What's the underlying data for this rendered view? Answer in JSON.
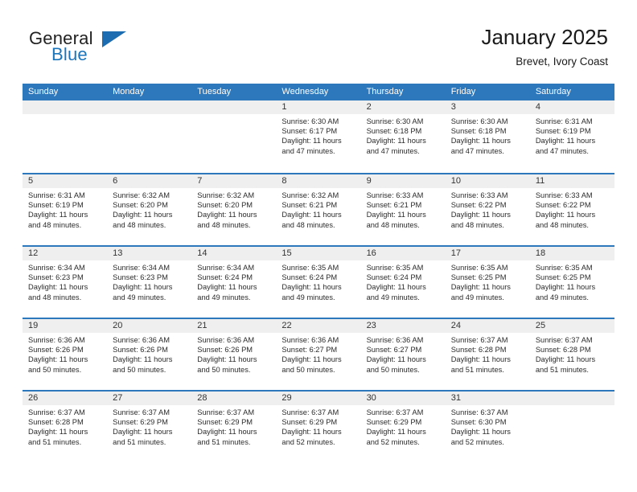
{
  "brand": {
    "word1": "General",
    "word2": "Blue",
    "flag_icon": "triangle-flag-icon"
  },
  "header": {
    "title": "January 2025",
    "subtitle": "Brevet, Ivory Coast"
  },
  "colors": {
    "header_blue": "#2d78bd",
    "brand_blue": "#1b75bb",
    "daynum_band": "#efefef",
    "text": "#2b2b2b"
  },
  "weekdays": [
    "Sunday",
    "Monday",
    "Tuesday",
    "Wednesday",
    "Thursday",
    "Friday",
    "Saturday"
  ],
  "weeks": [
    [
      {
        "day": "",
        "sunrise": "",
        "sunset": "",
        "daylight1": "",
        "daylight2": ""
      },
      {
        "day": "",
        "sunrise": "",
        "sunset": "",
        "daylight1": "",
        "daylight2": ""
      },
      {
        "day": "",
        "sunrise": "",
        "sunset": "",
        "daylight1": "",
        "daylight2": ""
      },
      {
        "day": "1",
        "sunrise": "Sunrise: 6:30 AM",
        "sunset": "Sunset: 6:17 PM",
        "daylight1": "Daylight: 11 hours",
        "daylight2": "and 47 minutes."
      },
      {
        "day": "2",
        "sunrise": "Sunrise: 6:30 AM",
        "sunset": "Sunset: 6:18 PM",
        "daylight1": "Daylight: 11 hours",
        "daylight2": "and 47 minutes."
      },
      {
        "day": "3",
        "sunrise": "Sunrise: 6:30 AM",
        "sunset": "Sunset: 6:18 PM",
        "daylight1": "Daylight: 11 hours",
        "daylight2": "and 47 minutes."
      },
      {
        "day": "4",
        "sunrise": "Sunrise: 6:31 AM",
        "sunset": "Sunset: 6:19 PM",
        "daylight1": "Daylight: 11 hours",
        "daylight2": "and 47 minutes."
      }
    ],
    [
      {
        "day": "5",
        "sunrise": "Sunrise: 6:31 AM",
        "sunset": "Sunset: 6:19 PM",
        "daylight1": "Daylight: 11 hours",
        "daylight2": "and 48 minutes."
      },
      {
        "day": "6",
        "sunrise": "Sunrise: 6:32 AM",
        "sunset": "Sunset: 6:20 PM",
        "daylight1": "Daylight: 11 hours",
        "daylight2": "and 48 minutes."
      },
      {
        "day": "7",
        "sunrise": "Sunrise: 6:32 AM",
        "sunset": "Sunset: 6:20 PM",
        "daylight1": "Daylight: 11 hours",
        "daylight2": "and 48 minutes."
      },
      {
        "day": "8",
        "sunrise": "Sunrise: 6:32 AM",
        "sunset": "Sunset: 6:21 PM",
        "daylight1": "Daylight: 11 hours",
        "daylight2": "and 48 minutes."
      },
      {
        "day": "9",
        "sunrise": "Sunrise: 6:33 AM",
        "sunset": "Sunset: 6:21 PM",
        "daylight1": "Daylight: 11 hours",
        "daylight2": "and 48 minutes."
      },
      {
        "day": "10",
        "sunrise": "Sunrise: 6:33 AM",
        "sunset": "Sunset: 6:22 PM",
        "daylight1": "Daylight: 11 hours",
        "daylight2": "and 48 minutes."
      },
      {
        "day": "11",
        "sunrise": "Sunrise: 6:33 AM",
        "sunset": "Sunset: 6:22 PM",
        "daylight1": "Daylight: 11 hours",
        "daylight2": "and 48 minutes."
      }
    ],
    [
      {
        "day": "12",
        "sunrise": "Sunrise: 6:34 AM",
        "sunset": "Sunset: 6:23 PM",
        "daylight1": "Daylight: 11 hours",
        "daylight2": "and 48 minutes."
      },
      {
        "day": "13",
        "sunrise": "Sunrise: 6:34 AM",
        "sunset": "Sunset: 6:23 PM",
        "daylight1": "Daylight: 11 hours",
        "daylight2": "and 49 minutes."
      },
      {
        "day": "14",
        "sunrise": "Sunrise: 6:34 AM",
        "sunset": "Sunset: 6:24 PM",
        "daylight1": "Daylight: 11 hours",
        "daylight2": "and 49 minutes."
      },
      {
        "day": "15",
        "sunrise": "Sunrise: 6:35 AM",
        "sunset": "Sunset: 6:24 PM",
        "daylight1": "Daylight: 11 hours",
        "daylight2": "and 49 minutes."
      },
      {
        "day": "16",
        "sunrise": "Sunrise: 6:35 AM",
        "sunset": "Sunset: 6:24 PM",
        "daylight1": "Daylight: 11 hours",
        "daylight2": "and 49 minutes."
      },
      {
        "day": "17",
        "sunrise": "Sunrise: 6:35 AM",
        "sunset": "Sunset: 6:25 PM",
        "daylight1": "Daylight: 11 hours",
        "daylight2": "and 49 minutes."
      },
      {
        "day": "18",
        "sunrise": "Sunrise: 6:35 AM",
        "sunset": "Sunset: 6:25 PM",
        "daylight1": "Daylight: 11 hours",
        "daylight2": "and 49 minutes."
      }
    ],
    [
      {
        "day": "19",
        "sunrise": "Sunrise: 6:36 AM",
        "sunset": "Sunset: 6:26 PM",
        "daylight1": "Daylight: 11 hours",
        "daylight2": "and 50 minutes."
      },
      {
        "day": "20",
        "sunrise": "Sunrise: 6:36 AM",
        "sunset": "Sunset: 6:26 PM",
        "daylight1": "Daylight: 11 hours",
        "daylight2": "and 50 minutes."
      },
      {
        "day": "21",
        "sunrise": "Sunrise: 6:36 AM",
        "sunset": "Sunset: 6:26 PM",
        "daylight1": "Daylight: 11 hours",
        "daylight2": "and 50 minutes."
      },
      {
        "day": "22",
        "sunrise": "Sunrise: 6:36 AM",
        "sunset": "Sunset: 6:27 PM",
        "daylight1": "Daylight: 11 hours",
        "daylight2": "and 50 minutes."
      },
      {
        "day": "23",
        "sunrise": "Sunrise: 6:36 AM",
        "sunset": "Sunset: 6:27 PM",
        "daylight1": "Daylight: 11 hours",
        "daylight2": "and 50 minutes."
      },
      {
        "day": "24",
        "sunrise": "Sunrise: 6:37 AM",
        "sunset": "Sunset: 6:28 PM",
        "daylight1": "Daylight: 11 hours",
        "daylight2": "and 51 minutes."
      },
      {
        "day": "25",
        "sunrise": "Sunrise: 6:37 AM",
        "sunset": "Sunset: 6:28 PM",
        "daylight1": "Daylight: 11 hours",
        "daylight2": "and 51 minutes."
      }
    ],
    [
      {
        "day": "26",
        "sunrise": "Sunrise: 6:37 AM",
        "sunset": "Sunset: 6:28 PM",
        "daylight1": "Daylight: 11 hours",
        "daylight2": "and 51 minutes."
      },
      {
        "day": "27",
        "sunrise": "Sunrise: 6:37 AM",
        "sunset": "Sunset: 6:29 PM",
        "daylight1": "Daylight: 11 hours",
        "daylight2": "and 51 minutes."
      },
      {
        "day": "28",
        "sunrise": "Sunrise: 6:37 AM",
        "sunset": "Sunset: 6:29 PM",
        "daylight1": "Daylight: 11 hours",
        "daylight2": "and 51 minutes."
      },
      {
        "day": "29",
        "sunrise": "Sunrise: 6:37 AM",
        "sunset": "Sunset: 6:29 PM",
        "daylight1": "Daylight: 11 hours",
        "daylight2": "and 52 minutes."
      },
      {
        "day": "30",
        "sunrise": "Sunrise: 6:37 AM",
        "sunset": "Sunset: 6:29 PM",
        "daylight1": "Daylight: 11 hours",
        "daylight2": "and 52 minutes."
      },
      {
        "day": "31",
        "sunrise": "Sunrise: 6:37 AM",
        "sunset": "Sunset: 6:30 PM",
        "daylight1": "Daylight: 11 hours",
        "daylight2": "and 52 minutes."
      },
      {
        "day": "",
        "sunrise": "",
        "sunset": "",
        "daylight1": "",
        "daylight2": ""
      }
    ]
  ]
}
